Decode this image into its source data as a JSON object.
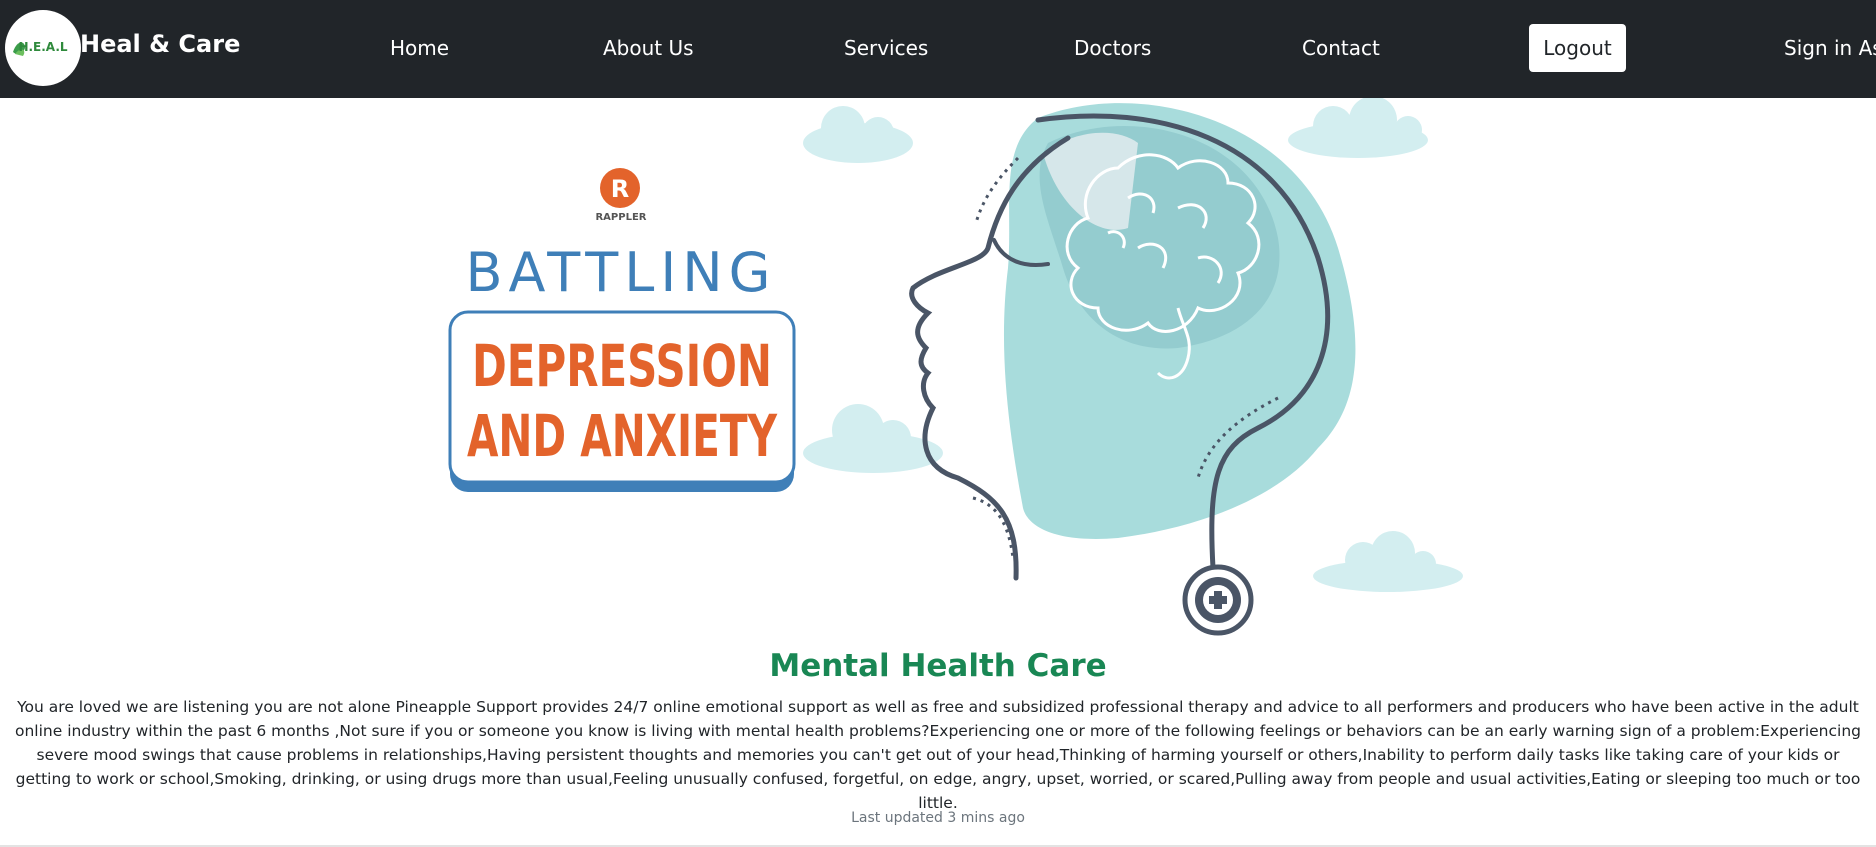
{
  "navbar": {
    "logo_text": "H.E.A.L",
    "brand": "Heal & Care",
    "links": [
      "Home",
      "About Us",
      "Services",
      "Doctors",
      "Contact"
    ],
    "logout_label": "Logout",
    "sign_in_text": "Sign in As:"
  },
  "hero": {
    "publisher": "RAPPLER",
    "line1": "BATTLING",
    "line2": "DEPRESSION",
    "line3": "AND ANXIETY"
  },
  "main": {
    "title": "Mental Health Care",
    "body": "You are loved we are listening you are not alone Pineapple Support provides 24/7 online emotional support as well as free and subsidized professional therapy and advice to all performers and producers who have been active in the adult online industry within the past 6 months ,Not sure if you or someone you know is living with mental health problems?Experiencing one or more of the following feelings or behaviors can be an early warning sign of a problem:Experiencing severe mood swings that cause problems in relationships,Having persistent thoughts and memories you can't get out of your head,Thinking of harming yourself or others,Inability to perform daily tasks like taking care of your kids or getting to work or school,Smoking, drinking, or using drugs more than usual,Feeling unusually confused, forgetful, on edge, angry, upset, worried, or scared,Pulling away from people and usual activities,Eating or sleeping too much or too little.",
    "updated": "Last updated 3 mins ago"
  },
  "colors": {
    "navbar_bg": "#212529",
    "title_green": "#198754",
    "battling_blue": "#3f7fb8",
    "depression_orange": "#e3632b",
    "head_teal": "#a8dcdc",
    "outline_dark": "#4a5566"
  },
  "icons": [
    "heal-logo-icon",
    "rappler-logo-icon",
    "brain-icon",
    "stethoscope-icon",
    "cloud-icon"
  ]
}
